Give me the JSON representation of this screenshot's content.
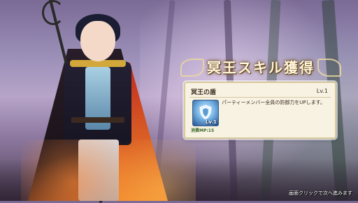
{
  "skill_header": {
    "title": "冥王スキル獲得"
  },
  "skill_card": {
    "name": "冥王の盾",
    "level": "Lv.1",
    "icon_level": "Lv.1",
    "cost_label": "消費MP:15",
    "description": "パーティーメンバー全員の防御力をUPします。",
    "icon": "shield-icon"
  },
  "footer": {
    "hint": "画面クリックで次へ進みます"
  },
  "colors": {
    "title_text": "#fff6df",
    "card_bg": "#f7f2e2",
    "card_border": "#d9c99c"
  }
}
